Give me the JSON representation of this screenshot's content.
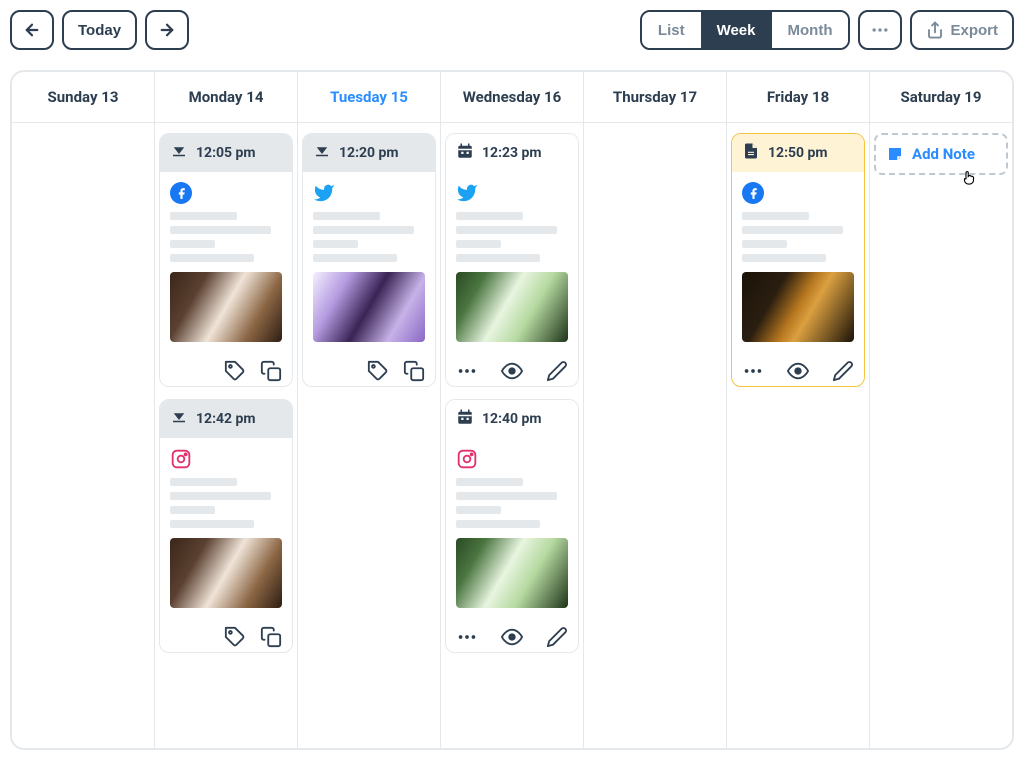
{
  "toolbar": {
    "today_label": "Today",
    "views": {
      "list": "List",
      "week": "Week",
      "month": "Month"
    },
    "export_label": "Export"
  },
  "add_note_label": "Add Note",
  "days": [
    {
      "label": "Sunday 13",
      "today": false,
      "posts": []
    },
    {
      "label": "Monday 14",
      "today": false,
      "posts": [
        {
          "time": "12:05 pm",
          "platform": "facebook",
          "status": "sent",
          "image": "coffee",
          "actions": [
            "tag",
            "copy"
          ]
        },
        {
          "time": "12:42 pm",
          "platform": "instagram",
          "status": "sent",
          "image": "coffee",
          "actions": [
            "tag",
            "copy"
          ]
        }
      ]
    },
    {
      "label": "Tuesday 15",
      "today": true,
      "posts": [
        {
          "time": "12:20 pm",
          "platform": "twitter",
          "status": "sent",
          "image": "berries",
          "actions": [
            "tag",
            "copy"
          ]
        }
      ]
    },
    {
      "label": "Wednesday 16",
      "today": false,
      "posts": [
        {
          "time": "12:23 pm",
          "platform": "twitter",
          "status": "scheduled",
          "image": "matcha",
          "actions": [
            "more",
            "view",
            "edit"
          ]
        },
        {
          "time": "12:40 pm",
          "platform": "instagram",
          "status": "scheduled",
          "image": "matcha",
          "actions": [
            "more",
            "view",
            "edit"
          ]
        }
      ]
    },
    {
      "label": "Thursday 17",
      "today": false,
      "posts": []
    },
    {
      "label": "Friday 18",
      "today": false,
      "posts": [
        {
          "time": "12:50 pm",
          "platform": "facebook",
          "status": "draft",
          "image": "whiskey",
          "actions": [
            "more",
            "view",
            "edit"
          ]
        }
      ]
    },
    {
      "label": "Saturday 19",
      "today": false,
      "posts": [],
      "show_add_note": true
    }
  ]
}
